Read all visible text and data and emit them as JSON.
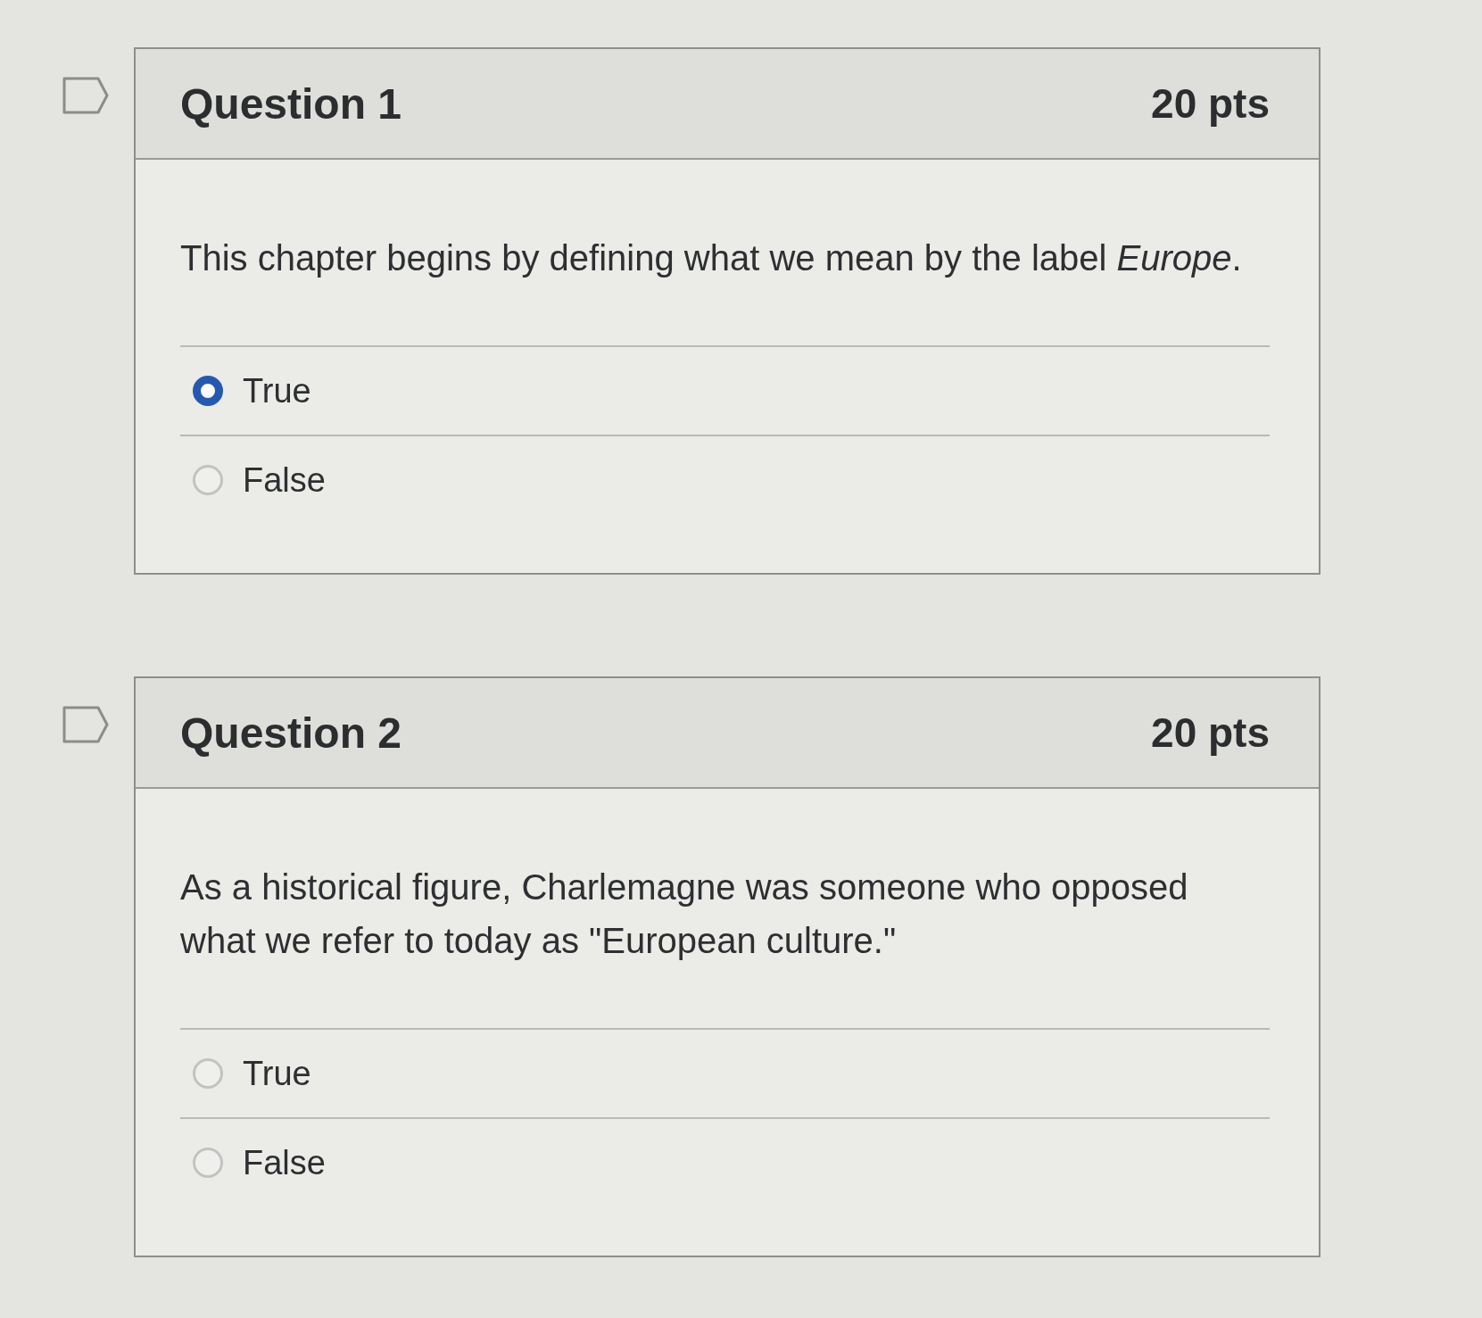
{
  "questions": [
    {
      "title": "Question 1",
      "points": "20 pts",
      "text": "This chapter begins by defining what we mean by the label *Europe*.",
      "answers": [
        {
          "label": "True",
          "selected": true
        },
        {
          "label": "False",
          "selected": false
        }
      ]
    },
    {
      "title": "Question 2",
      "points": "20 pts",
      "text": "As a historical figure, Charlemagne was someone who opposed what we refer to today as \"European culture.\"",
      "answers": [
        {
          "label": "True",
          "selected": false
        },
        {
          "label": "False",
          "selected": false
        }
      ]
    }
  ]
}
